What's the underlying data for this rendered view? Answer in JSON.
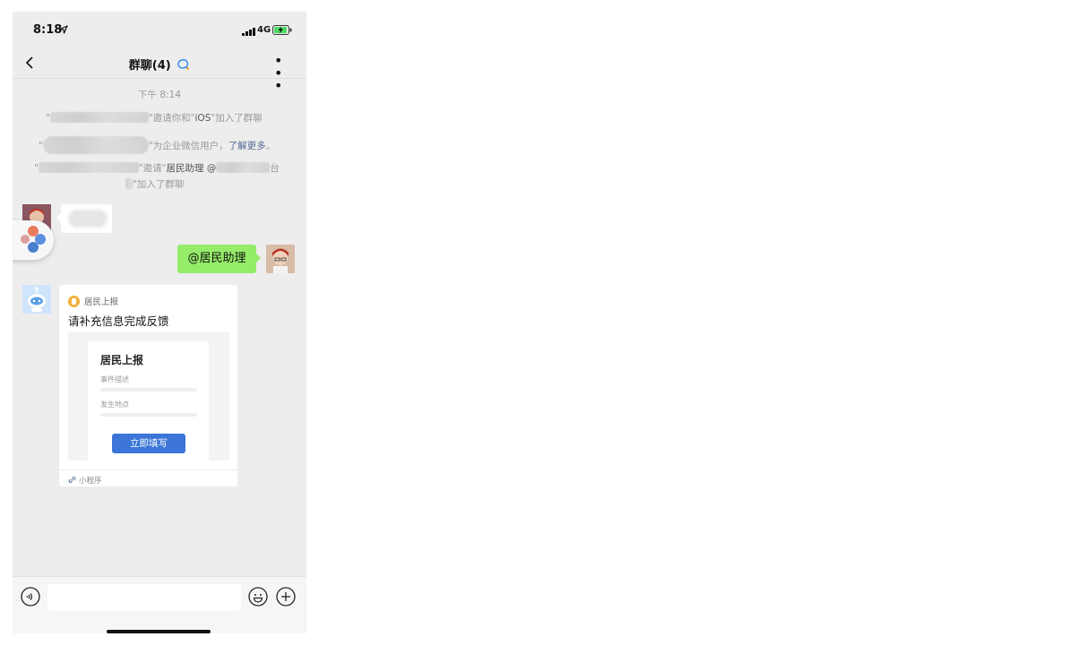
{
  "status": {
    "time": "8:18",
    "network": "4G"
  },
  "nav": {
    "title": "群聊",
    "member_count": "(4)"
  },
  "messages": {
    "timestamp": "下午 8:14",
    "sys1": {
      "q1": "\"",
      "text": "\"邀请你和\"",
      "ios": "iOS",
      "end": "\"加入了群聊"
    },
    "sys2": {
      "q1": "\"",
      "text": "\"为企业微信用户，",
      "link": "了解更多",
      "end": "。"
    },
    "sys3": {
      "q1": "\"",
      "text": "\"邀请\"",
      "name": "居民助理 @",
      "tail": "台",
      "line2_end": "\"加入了群聊"
    },
    "mention": "@居民助理"
  },
  "card": {
    "source": "居民上报",
    "title": "请补充信息完成反馈",
    "preview": {
      "form_title": "居民上报",
      "field1": "事件描述",
      "field2": "发生地点",
      "button": "立即填写"
    },
    "footer": "小程序"
  },
  "colors": {
    "bg": "#ededed",
    "green_bubble": "#95ec69",
    "link_blue": "#576b95",
    "button_blue": "#3b76d8",
    "source_icon": "#f5b03a"
  },
  "icons": [
    "location-arrow-icon",
    "signal-icon",
    "battery-charging-icon",
    "back-chevron-icon",
    "group-chat-icon",
    "more-icon",
    "voice-icon",
    "emoji-icon",
    "plus-icon",
    "link-icon",
    "mini-program-source-icon"
  ]
}
